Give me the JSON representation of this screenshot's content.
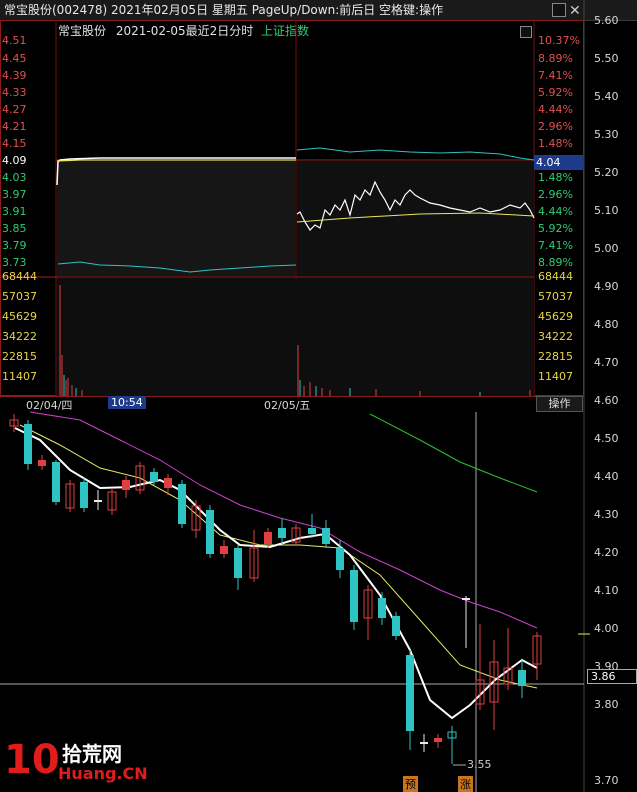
{
  "title_bar": {
    "text": "常宝股份(002478) 2021年02月05日 星期五 PageUp/Down:前后日 空格键:操作"
  },
  "intraday": {
    "stock_name": "常宝股份",
    "date_label": "2021-02-05最近2日分时",
    "index_label": "上证指数",
    "price_labels": [
      "4.51",
      "4.45",
      "4.39",
      "4.33",
      "4.27",
      "4.21",
      "4.15",
      "4.09",
      "4.03",
      "3.97",
      "3.91",
      "3.85",
      "3.79",
      "3.73"
    ],
    "pct_labels": [
      "10.37%",
      "8.89%",
      "7.41%",
      "5.92%",
      "4.44%",
      "2.96%",
      "1.48%",
      "",
      "1.48%",
      "2.96%",
      "4.44%",
      "5.92%",
      "7.41%",
      "8.89%"
    ],
    "volume_labels": [
      "68444",
      "57037",
      "45629",
      "34222",
      "22815",
      "11407"
    ],
    "current_price": "4.04",
    "time_labels": {
      "day1": "02/04/四",
      "cursor_time": "10:54",
      "day2": "02/05/五"
    },
    "op_button": "操作"
  },
  "right_axis": [
    "5.60",
    "5.50",
    "5.40",
    "5.30",
    "5.20",
    "5.10",
    "5.00",
    "4.90",
    "4.80",
    "4.70",
    "4.60",
    "4.50",
    "4.40",
    "4.30",
    "4.20",
    "4.10",
    "4.00",
    "3.90",
    "3.80",
    "3.70"
  ],
  "kline": {
    "current_price_tag": "3.86",
    "low_annotation": "3.55",
    "markers": [
      "预",
      "涨"
    ]
  },
  "logo": {
    "number": "10",
    "cn": "拾荒网",
    "domain": "Huang.CN"
  },
  "colors": {
    "up": "#e04040",
    "down": "#2ec4c4",
    "ma5": "#ffffff",
    "ma10": "#e8e860",
    "ma20": "#d040d0",
    "ma60": "#30c030",
    "panel_border": "#8b1a1a"
  }
}
